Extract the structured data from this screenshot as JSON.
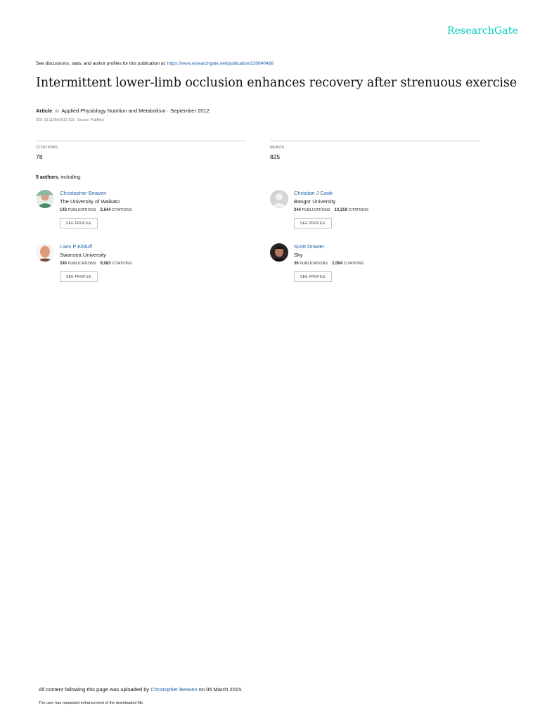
{
  "logo": "ResearchGate",
  "header": {
    "intro": "See discussions, stats, and author profiles for this publication at: ",
    "link": "https://www.researchgate.net/publication/230840488"
  },
  "paper": {
    "title": "Intermittent lower-limb occlusion enhances recovery after strenuous exercise",
    "type": "Article",
    "in_label": "in",
    "journal_date": "Applied Physiology Nutrition and Metabolism · September 2012",
    "doi_source": "DOI: 10.1139/h2012-101 · Source: PubMed"
  },
  "stats": {
    "citations_label": "CITATIONS",
    "citations_value": "78",
    "reads_label": "READS",
    "reads_value": "825"
  },
  "authors_heading": {
    "count": "5 authors",
    "suffix": ", including:"
  },
  "authors": [
    {
      "name": "Christopher Beaven",
      "institution": "The University of Waikato",
      "publications": "143",
      "publications_label": "PUBLICATIONS",
      "citations": "2,644",
      "citations_label": "CITATIONS",
      "button": "SEE PROFILE",
      "avatar_color": "#4a8a6a"
    },
    {
      "name": "Christian J Cook",
      "institution": "Bangor University",
      "publications": "244",
      "publications_label": "PUBLICATIONS",
      "citations": "10,219",
      "citations_label": "CITATIONS",
      "button": "SEE PROFILE",
      "avatar_color": "#c8c8c8"
    },
    {
      "name": "Liam P Kilduff",
      "institution": "Swansea University",
      "publications": "240",
      "publications_label": "PUBLICATIONS",
      "citations": "9,083",
      "citations_label": "CITATIONS",
      "button": "SEE PROFILE",
      "avatar_color": "#d98a6e"
    },
    {
      "name": "Scott Drawer",
      "institution": "Sky",
      "publications": "36",
      "publications_label": "PUBLICATIONS",
      "citations": "2,064",
      "citations_label": "CITATIONS",
      "button": "SEE PROFILE",
      "avatar_color": "#3a3030"
    }
  ],
  "footer": {
    "uploaded_prefix": "All content following this page was uploaded by ",
    "uploader": "Christopher Beaven",
    "uploaded_suffix": " on 05 March 2015.",
    "note": "The user has requested enhancement of the downloaded file."
  },
  "colors": {
    "brand": "#00ccbb",
    "link": "#1f5fa8"
  }
}
